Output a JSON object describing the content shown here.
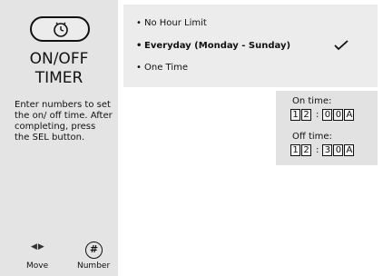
{
  "sidebar": {
    "icon": "timer-clock-icon",
    "title_line1": "ON/OFF",
    "title_line2": "TIMER",
    "help_text": "Enter numbers to set the on/ off time. After completing, press the SEL button.",
    "move_icon": "left-right-arrows-icon",
    "move_label": "Move",
    "number_icon": "hash-icon",
    "number_symbol": "#",
    "number_label": "Number"
  },
  "options": [
    {
      "label": "No Hour Limit",
      "selected": false
    },
    {
      "label": "Everyday (Monday - Sunday)",
      "selected": true
    },
    {
      "label": "One Time",
      "selected": false
    }
  ],
  "check_icon": "checkmark-icon",
  "times": {
    "on_label": "On time:",
    "on_hour": [
      "1",
      "2"
    ],
    "on_minute": [
      "0",
      "0"
    ],
    "on_ampm": "A",
    "off_label": "Off time:",
    "off_hour": [
      "1",
      "2"
    ],
    "off_minute": [
      "3",
      "0"
    ],
    "off_ampm": "A",
    "separator": ":"
  },
  "colors": {
    "sidebar_bg": "#e4e4e4",
    "panel_bg": "#ececec",
    "text": "#111111"
  }
}
